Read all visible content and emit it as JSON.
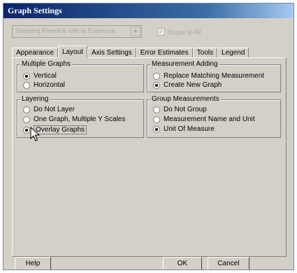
{
  "window": {
    "title": "Graph Settings"
  },
  "top": {
    "combo_value": "Stepping Potential with te Exposure",
    "checkbox_label": "Scope to All",
    "checkbox_checked": true
  },
  "tabs": [
    {
      "label": "Appearance",
      "active": false
    },
    {
      "label": "Layout",
      "active": true
    },
    {
      "label": "Axis Settings",
      "active": false
    },
    {
      "label": "Error Estimates",
      "active": false
    },
    {
      "label": "Tools",
      "active": false
    },
    {
      "label": "Legend",
      "active": false
    }
  ],
  "groups": {
    "multiple_graphs": {
      "title": "Multiple Graphs",
      "options": [
        {
          "label": "Vertical",
          "selected": true
        },
        {
          "label": "Horizontal",
          "selected": false
        }
      ]
    },
    "measurement_adding": {
      "title": "Measurement Adding",
      "options": [
        {
          "label": "Replace Matching Measurement",
          "selected": false
        },
        {
          "label": "Create New Graph",
          "selected": true
        }
      ]
    },
    "layering": {
      "title": "Layering",
      "options": [
        {
          "label": "Do Not Layer",
          "selected": false
        },
        {
          "label": "One Graph, Multiple Y Scales",
          "selected": false
        },
        {
          "label": "Overlay Graphs",
          "selected": true
        }
      ]
    },
    "group_measurements": {
      "title": "Group Measurements",
      "options": [
        {
          "label": "Do Not Group",
          "selected": false
        },
        {
          "label": "Measurement Name and Unit",
          "selected": false
        },
        {
          "label": "Unit Of Measure",
          "selected": true
        }
      ]
    }
  },
  "buttons": {
    "help": "Help",
    "ok": "OK",
    "cancel": "Cancel"
  }
}
